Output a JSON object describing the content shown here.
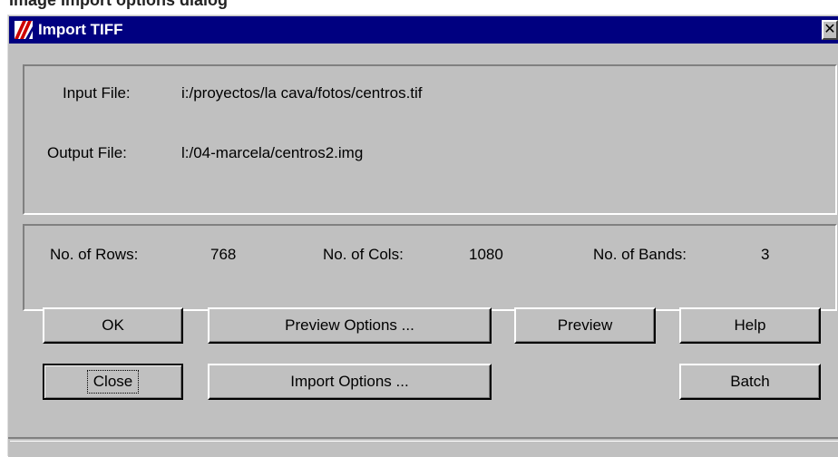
{
  "background_caption": "Image Import options dialog",
  "window": {
    "title": "Import TIFF",
    "close_symbol": "✕",
    "colors": {
      "titlebar": "#000080",
      "face": "#c0c0c0"
    },
    "icon": "app-logo-icon"
  },
  "files": {
    "input_label": "Input File:",
    "input_value": "i:/proyectos/la cava/fotos/centros.tif",
    "output_label": "Output File:",
    "output_value": "l:/04-marcela/centros2.img"
  },
  "dimensions": {
    "rows_label": "No. of Rows:",
    "rows_value": "768",
    "cols_label": "No. of Cols:",
    "cols_value": "1080",
    "bands_label": "No. of Bands:",
    "bands_value": "3"
  },
  "buttons": {
    "ok": "OK",
    "preview_options": "Preview Options ...",
    "preview": "Preview",
    "help": "Help",
    "close": "Close",
    "import_options": "Import Options ...",
    "batch": "Batch"
  }
}
